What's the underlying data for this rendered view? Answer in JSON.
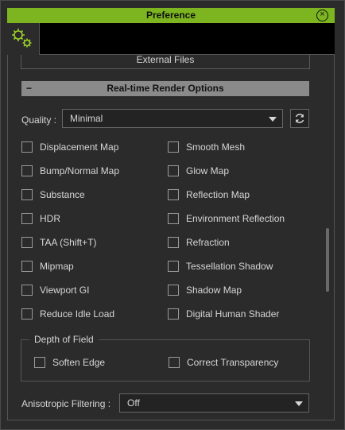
{
  "window": {
    "title": "Preference"
  },
  "panel": {
    "external_files_label": "External Files",
    "section_title": "Real-time Render Options",
    "collapse_symbol": "−",
    "quality": {
      "label": "Quality :",
      "value": "Minimal"
    },
    "options_left": [
      {
        "label": "Displacement Map",
        "checked": false
      },
      {
        "label": "Bump/Normal Map",
        "checked": false
      },
      {
        "label": "Substance",
        "checked": false
      },
      {
        "label": "HDR",
        "checked": false
      },
      {
        "label": "TAA (Shift+T)",
        "checked": false
      },
      {
        "label": "Mipmap",
        "checked": false
      },
      {
        "label": "Viewport GI",
        "checked": false
      },
      {
        "label": "Reduce Idle Load",
        "checked": false
      }
    ],
    "options_right": [
      {
        "label": "Smooth Mesh",
        "checked": false
      },
      {
        "label": "Glow Map",
        "checked": false
      },
      {
        "label": "Reflection Map",
        "checked": false
      },
      {
        "label": "Environment Reflection",
        "checked": false
      },
      {
        "label": "Refraction",
        "checked": false
      },
      {
        "label": "Tessellation Shadow",
        "checked": false
      },
      {
        "label": "Shadow Map",
        "checked": false
      },
      {
        "label": "Digital Human Shader",
        "checked": false
      }
    ],
    "depth_of_field": {
      "title": "Depth of Field",
      "soften_edge": "Soften Edge",
      "correct_transparency": "Correct Transparency"
    },
    "anisotropic": {
      "label": "Anisotropic Filtering :",
      "value": "Off"
    }
  },
  "colors": {
    "accent": "#7cb51f",
    "section_header": "#8a8a8a",
    "background": "#2b2b2b"
  },
  "icons": {
    "close": "close-icon",
    "settings_tab": "gears-icon",
    "reset": "refresh-icon"
  }
}
